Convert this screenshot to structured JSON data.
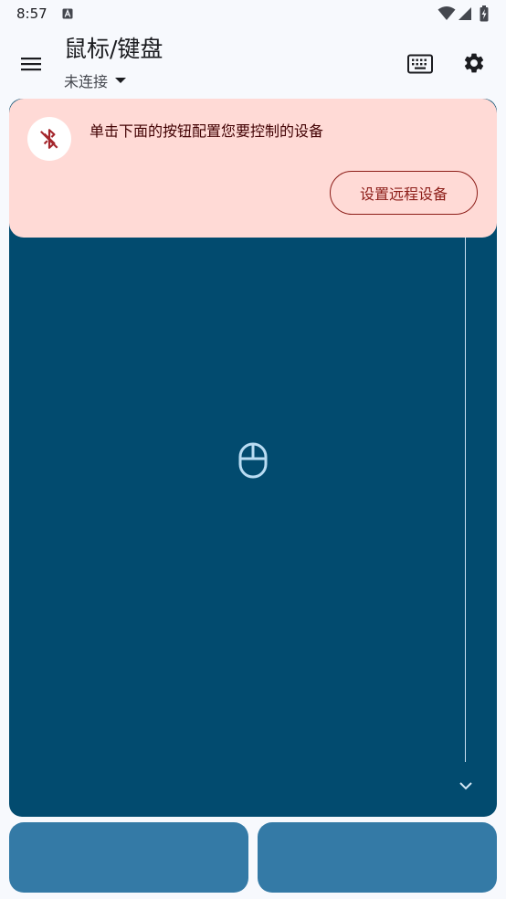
{
  "status_bar": {
    "time": "8:57",
    "icons": [
      "accessibility-a-icon",
      "wifi-icon",
      "signal-icon",
      "battery-charging-icon"
    ]
  },
  "app_bar": {
    "title": "鼠标/键盘",
    "subtitle": "未连接",
    "icons": [
      "menu-icon",
      "keyboard-icon",
      "settings-icon"
    ]
  },
  "banner": {
    "message": "单击下面的按钮配置您要控制的设备",
    "button_label": "设置远程设备",
    "icon": "bluetooth-disabled-icon"
  },
  "touchpad": {
    "icons": [
      "mouse-icon",
      "chevron-down-icon"
    ]
  },
  "colors": {
    "touchpad": "#024b6f",
    "mouse_buttons": "#347aa6",
    "banner_bg": "#ffdad6",
    "banner_accent": "#8c1d18",
    "background": "#f7f9fd"
  }
}
